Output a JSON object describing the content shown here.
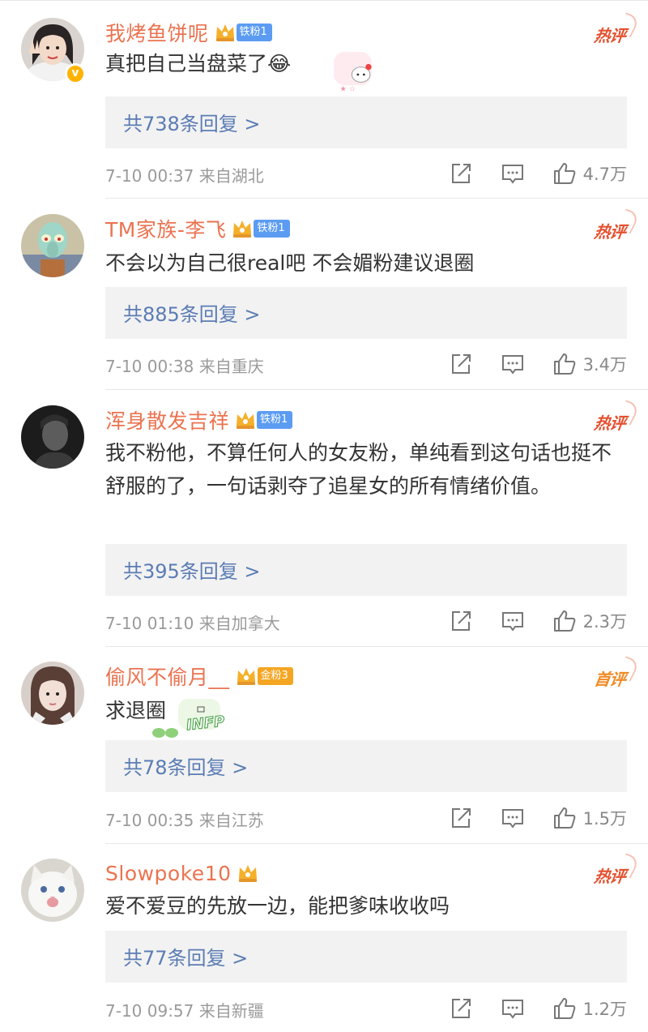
{
  "colors": {
    "username": "#eb7350",
    "reply_link": "#5b7cb4",
    "hot": "#e5502f",
    "first": "#f08a24",
    "iron_badge": "#5b9cf2",
    "gold_badge": "#f4a623"
  },
  "comments": [
    {
      "username": "我烤鱼饼呢",
      "badge": "铁粉1",
      "tag": "热评",
      "text": "真把自己当盘菜了",
      "emoji": "😂",
      "replies": "共738条回复 >",
      "meta": "7-10 00:37 来自湖北",
      "likes": "4.7万",
      "avatar_icon": "girl-peace-sign-avatar",
      "verified": true
    },
    {
      "username": "TM家族-李飞",
      "badge": "铁粉1",
      "tag": "热评",
      "text": "不会以为自己很real吧 不会媚粉建议退圈",
      "replies": "共885条回复 >",
      "meta": "7-10 00:38 来自重庆",
      "likes": "3.4万",
      "avatar_icon": "squidward-avatar"
    },
    {
      "username": "浑身散发吉祥",
      "badge": "铁粉1",
      "tag": "热评",
      "text": "我不粉他，不算任何人的女友粉，单纯看到这句话也挺不舒服的了，一句话剥夺了追星女的所有情绪价值。",
      "replies": "共395条回复 >",
      "meta": "7-10 01:10 来自加拿大",
      "likes": "2.3万",
      "avatar_icon": "dark-portrait-avatar"
    },
    {
      "username": "偷风不偷月__",
      "badge": "金粉3",
      "tag": "首评",
      "text": "求退圈",
      "replies": "共78条回复 >",
      "meta": "7-10 00:35 来自江苏",
      "likes": "1.5万",
      "avatar_icon": "girl-selfie-avatar",
      "sticker": "INFP"
    },
    {
      "username": "Slowpoke10",
      "tag": "热评",
      "text": "爱不爱豆的先放一边，能把爹味收收吗",
      "replies": "共77条回复 >",
      "meta": "7-10 09:57 来自新疆",
      "likes": "1.2万",
      "avatar_icon": "white-cat-avatar"
    }
  ]
}
